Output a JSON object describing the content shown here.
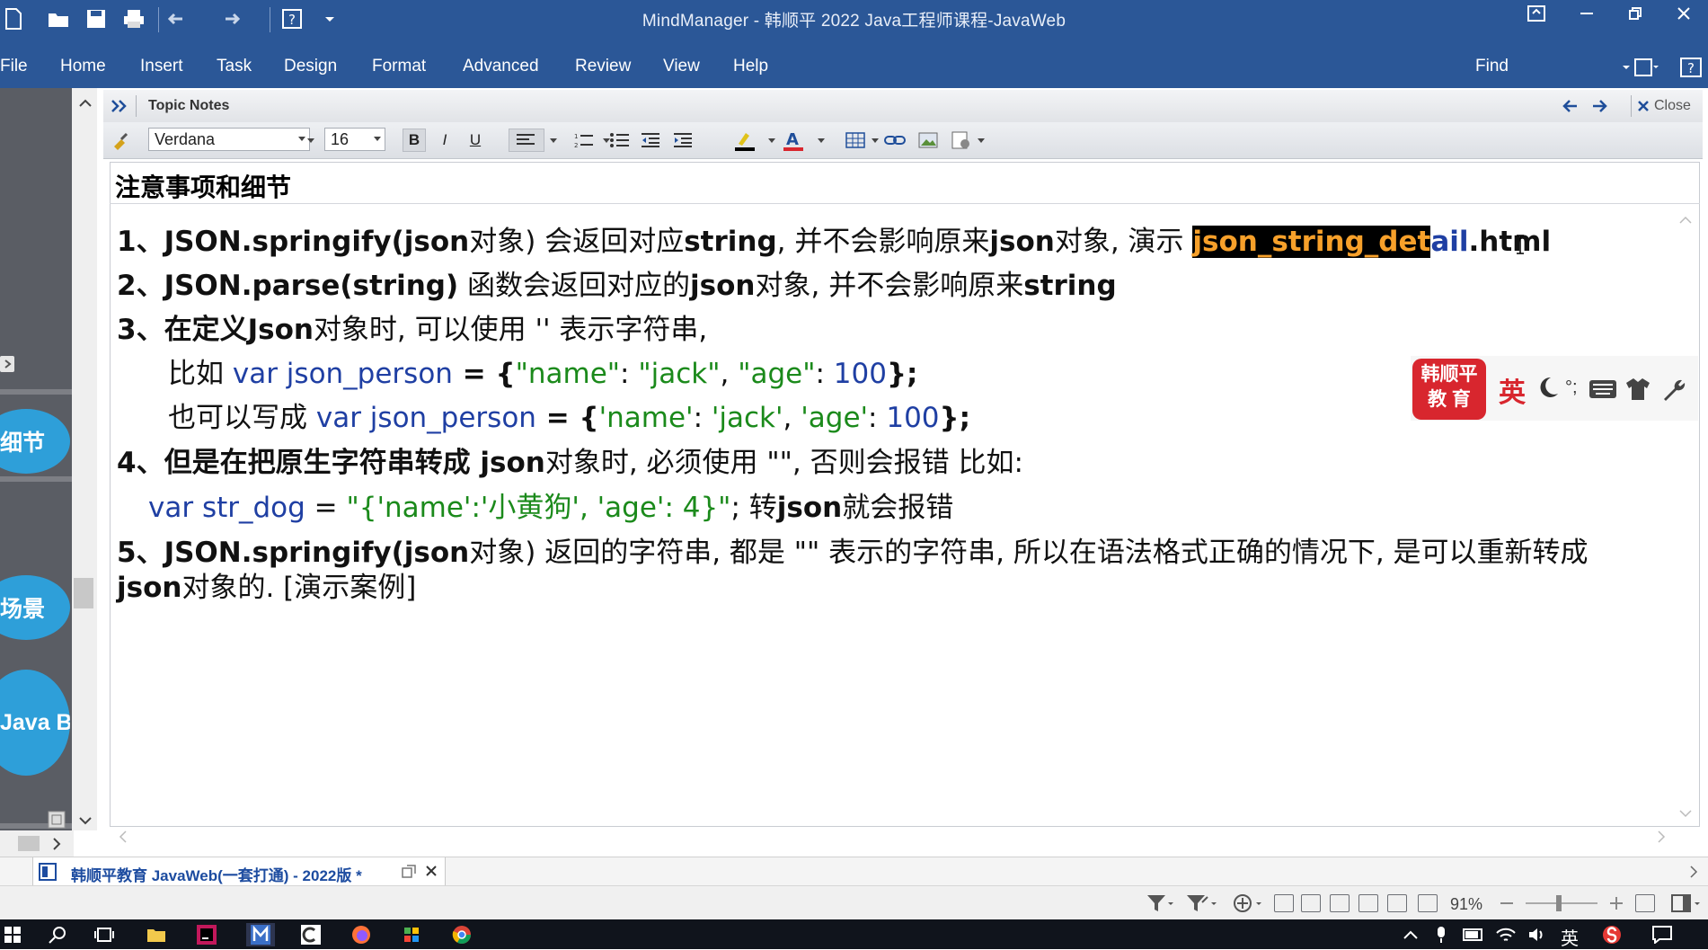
{
  "window": {
    "title": "MindManager - 韩顺平 2022 Java工程师课程-JavaWeb"
  },
  "menu": {
    "items": [
      "File",
      "Home",
      "Insert",
      "Task",
      "Design",
      "Format",
      "Advanced",
      "Review",
      "View",
      "Help"
    ],
    "find_label": "Find"
  },
  "left_panel": {
    "bubbles": [
      "细节",
      "场景",
      "Java Bo"
    ]
  },
  "notes_panel": {
    "title": "Topic Notes",
    "close_label": "Close",
    "font_name": "Verdana",
    "font_size": "16"
  },
  "note": {
    "heading": "注意事项和细节",
    "l1_a": "1、JSON.springify(json",
    "l1_b": "对象) 会返回对应",
    "l1_c": "string",
    "l1_d": ", 并不会影响原来",
    "l1_e": "json",
    "l1_f": "对象, 演示 ",
    "l1_hl": "json_string_det",
    "l1_hl2": "ail",
    "l1_g": ".html",
    "l2_a": "2、JSON.parse(string)",
    "l2_b": " 函数会返回对应的",
    "l2_c": "json",
    "l2_d": "对象, 并不会影响原来",
    "l2_e": "string",
    "l3_a": "3、在定义",
    "l3_b": "Json",
    "l3_c": "对象时, 可以使用 '' 表示字符串,",
    "l4_a": "比如 ",
    "l4_var": "var",
    "l4_name": " json_person",
    "l4_eq": " = {",
    "l4_k1": "\"name\"",
    "l4_c1": ": ",
    "l4_v1": "\"jack\"",
    "l4_c2": ", ",
    "l4_k2": "\"age\"",
    "l4_c3": ": ",
    "l4_v2": "100",
    "l4_end": "};",
    "l5_a": "也可以写成 ",
    "l5_var": "var",
    "l5_name": " json_person",
    "l5_eq": " = {",
    "l5_k1": "'name'",
    "l5_c1": ": ",
    "l5_v1": "'jack'",
    "l5_c2": ", ",
    "l5_k2": "'age'",
    "l5_c3": ": ",
    "l5_v2": "100",
    "l5_end": "};",
    "l6_a": "4、但是在把原生字符串转成 ",
    "l6_b": "json",
    "l6_c": "对象时, 必须使用 \"\", 否则会报错 比如:",
    "l7_var": "var",
    "l7_name": " str_dog",
    "l7_eq": " = ",
    "l7_str": "\"{'name':'小黄狗', 'age': 4}\"",
    "l7_a": "; 转",
    "l7_b": "json",
    "l7_c": "就会报错",
    "l8_a": "5、JSON.springify(json",
    "l8_b": "对象) 返回的字符串, 都是 \"\" 表示的字符串, 所以在语法格式正确的情况下, 是可以重新转成",
    "l9_a": "json",
    "l9_b": "对象的. [演示案例]"
  },
  "badge": {
    "logo_line1": "韩顺平",
    "logo_line2": "教 育",
    "lang": "英"
  },
  "tabs": {
    "doc_label": "韩顺平教育 JavaWeb(一套打通) - 2022版 *"
  },
  "status": {
    "zoom": "91%"
  },
  "taskbar": {
    "ime": "英"
  },
  "colors": {
    "titlebar": "#2b5797",
    "bubble": "#2e9fd9",
    "keyword": "#1f3fa3",
    "string": "#1b8a1b",
    "highlight_bg": "#000000",
    "highlight_fg": "#f7a02a",
    "brand_red": "#d8262e"
  }
}
